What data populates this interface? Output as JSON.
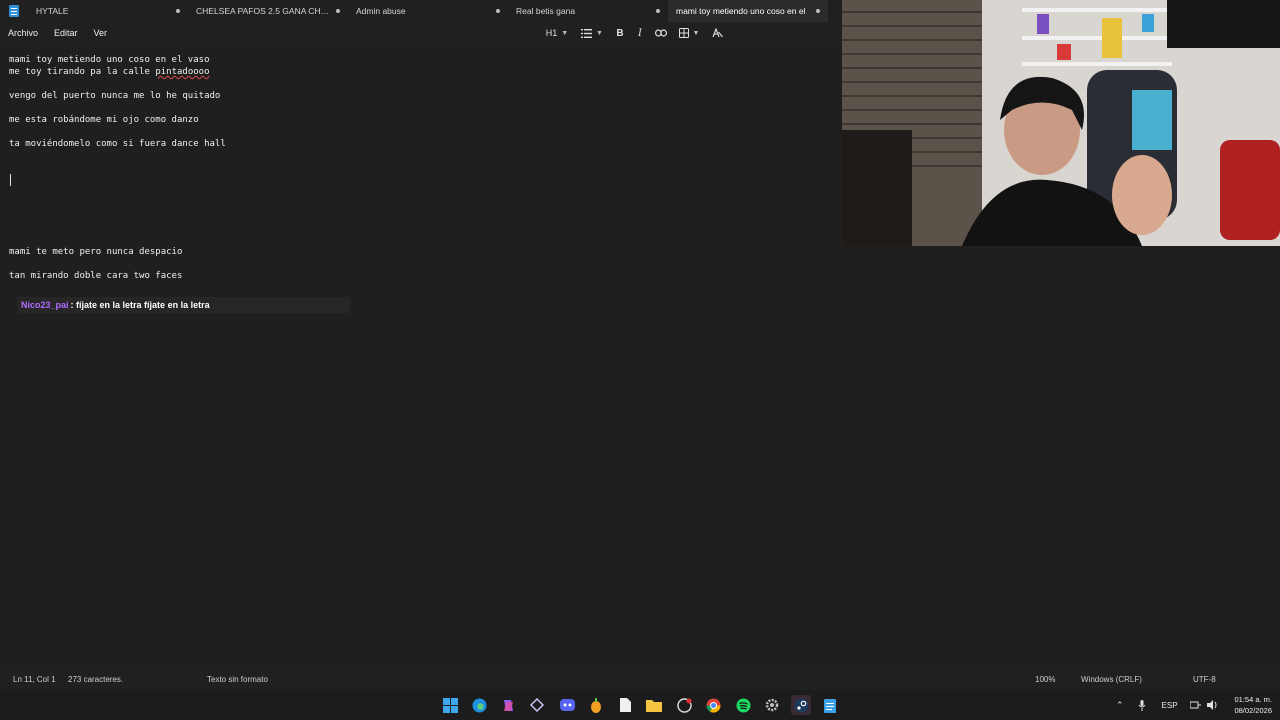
{
  "tabs": [
    {
      "label": "HYTALE",
      "active": false
    },
    {
      "label": "CHELSEA PAFOS 2.5 GANA CHELSEA",
      "active": false
    },
    {
      "label": "Admin abuse",
      "active": false
    },
    {
      "label": "Real betis gana",
      "active": false
    },
    {
      "label": "mami toy metiendo uno coso en el",
      "active": true
    }
  ],
  "menu": {
    "file": "Archivo",
    "edit": "Editar",
    "view": "Ver"
  },
  "toolbar": {
    "heading": "H1",
    "bold": "B",
    "italic": "I"
  },
  "editor": {
    "lines": [
      "mami toy metiendo uno coso en el vaso",
      "me toy tirando pa la calle ",
      "vengo del puerto nunca me lo he quitado",
      "me esta robándome mi ojo como danzo",
      "ta moviéndomelo como si fuera dance hall",
      "mami te meto pero nunca despacio",
      "tan mirando doble cara two faces"
    ],
    "misspelled": "pintadoooo"
  },
  "chat": {
    "user": "Nico23_pai",
    "message": ": fíjate en la letra fíjate en la letra"
  },
  "status": {
    "position": "Ln 11, Col 1",
    "chars": "273 caracteres.",
    "format": "Texto sin formato",
    "zoom": "100%",
    "line_ending": "Windows (CRLF)",
    "encoding": "UTF-8"
  },
  "taskbar": {
    "lang": "ESP",
    "time": "01:54 a. m.",
    "date": "08/02/2026"
  },
  "colors": {
    "chat_user": "#b06cff",
    "accent": "#2f8fd8",
    "spell_error": "#e04848"
  }
}
